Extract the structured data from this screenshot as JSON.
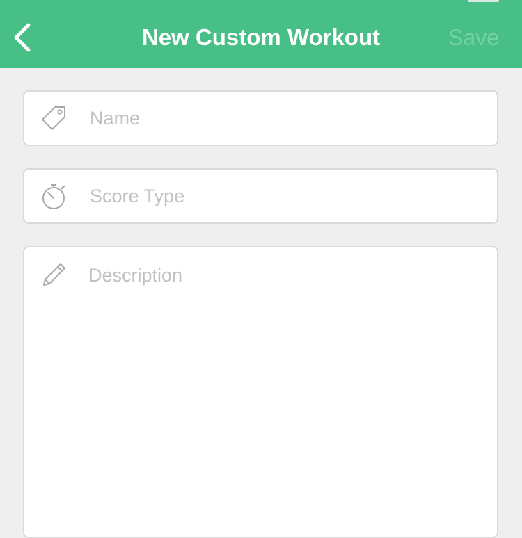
{
  "colors": {
    "header_bg": "#47bf86",
    "title_text": "#ffffff",
    "save_disabled_text": "#74d3a5",
    "background": "#efefef",
    "placeholder_text": "#c0c0c5",
    "field_border": "#d9d9d9"
  },
  "header": {
    "back_icon": "chevron-left-icon",
    "title": "New Custom Workout",
    "save_label": "Save"
  },
  "form": {
    "name": {
      "icon": "tag-icon",
      "placeholder": "Name"
    },
    "score_type": {
      "icon": "stopwatch-icon",
      "placeholder": "Score Type"
    },
    "description": {
      "icon": "pencil-icon",
      "placeholder": "Description"
    }
  }
}
